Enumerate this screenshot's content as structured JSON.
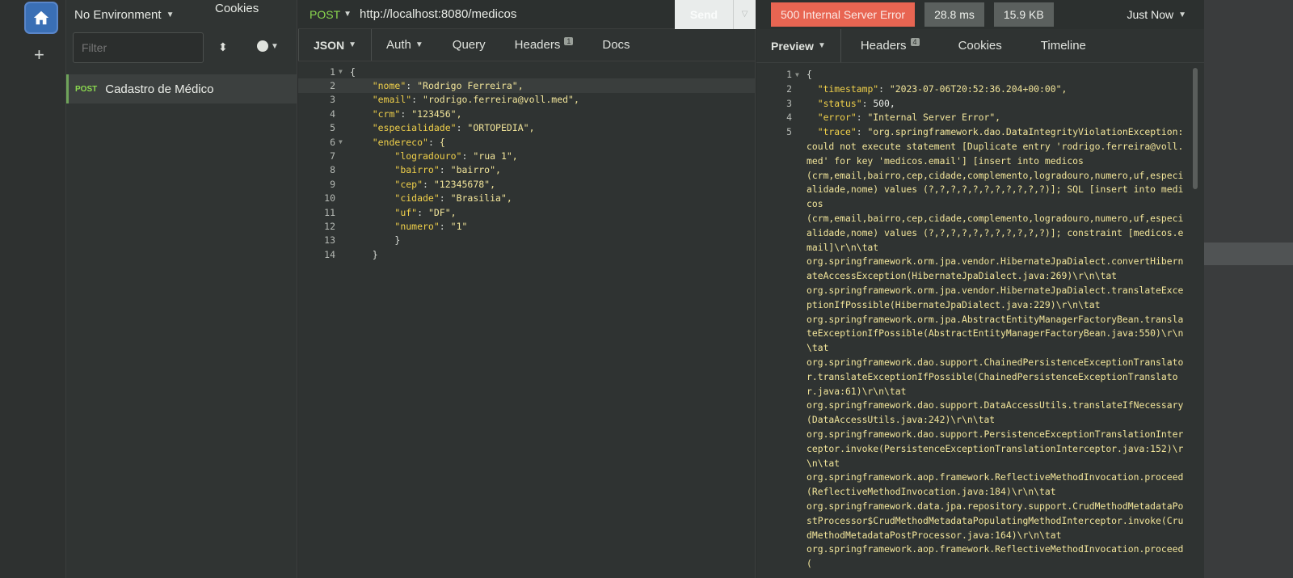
{
  "rail": {
    "home_icon": "home-icon",
    "add_label": "+"
  },
  "sidebar": {
    "environment": "No Environment",
    "cookies": "Cookies",
    "filter_placeholder": "Filter",
    "request": {
      "method": "POST",
      "name": "Cadastro de Médico"
    }
  },
  "request": {
    "method": "POST",
    "url": "http://localhost:8080/medicos",
    "send_label": "Send",
    "tabs": [
      {
        "label": "JSON",
        "badge": ""
      },
      {
        "label": "Auth",
        "badge": ""
      },
      {
        "label": "Query",
        "badge": ""
      },
      {
        "label": "Headers",
        "badge": "1"
      },
      {
        "label": "Docs",
        "badge": ""
      }
    ],
    "body_lines": [
      {
        "n": "1",
        "text": "{"
      },
      {
        "n": "2",
        "key": "\"nome\"",
        "val": "\"Rodrigo Ferreira\","
      },
      {
        "n": "3",
        "key": "\"email\"",
        "val": "\"rodrigo.ferreira@voll.med\","
      },
      {
        "n": "4",
        "key": "\"crm\"",
        "val": "\"123456\","
      },
      {
        "n": "5",
        "key": "\"especialidade\"",
        "val": "\"ORTOPEDIA\","
      },
      {
        "n": "6",
        "key": "\"endereco\"",
        "val": "{"
      },
      {
        "n": "7",
        "key": "\"logradouro\"",
        "val": "\"rua 1\","
      },
      {
        "n": "8",
        "key": "\"bairro\"",
        "val": "\"bairro\","
      },
      {
        "n": "9",
        "key": "\"cep\"",
        "val": "\"12345678\","
      },
      {
        "n": "10",
        "key": "\"cidade\"",
        "val": "\"Brasilia\","
      },
      {
        "n": "11",
        "key": "\"uf\"",
        "val": "\"DF\","
      },
      {
        "n": "12",
        "key": "\"numero\"",
        "val": "\"1\""
      },
      {
        "n": "13",
        "text": "}"
      },
      {
        "n": "14",
        "text": "}"
      }
    ]
  },
  "response": {
    "status": "500 Internal Server Error",
    "time": "28.8 ms",
    "size": "15.9 KB",
    "time_ago": "Just Now",
    "tabs": [
      {
        "label": "Preview",
        "badge": ""
      },
      {
        "label": "Headers",
        "badge": "4"
      },
      {
        "label": "Cookies",
        "badge": ""
      },
      {
        "label": "Timeline",
        "badge": ""
      }
    ],
    "lines": [
      {
        "n": "1",
        "text": "{"
      },
      {
        "n": "2",
        "key": "\"timestamp\"",
        "val": "\"2023-07-06T20:52:36.204+00:00\","
      },
      {
        "n": "3",
        "key": "\"status\"",
        "val": "500,"
      },
      {
        "n": "4",
        "key": "\"error\"",
        "val": "\"Internal Server Error\","
      },
      {
        "n": "5",
        "key": "\"trace\"",
        "val": "\"org.springframework.dao.DataIntegrityViolationException:"
      }
    ],
    "trace_continuation": "could not execute statement [Duplicate entry 'rodrigo.ferreira@voll.med' for key 'medicos.email'] [insert into medicos\n(crm,email,bairro,cep,cidade,complemento,logradouro,numero,uf,especialidade,nome) values (?,?,?,?,?,?,?,?,?,?,?)]; SQL [insert into medicos\n(crm,email,bairro,cep,cidade,complemento,logradouro,numero,uf,especialidade,nome) values (?,?,?,?,?,?,?,?,?,?,?)]; constraint [medicos.email]\\r\\n\\tat\norg.springframework.orm.jpa.vendor.HibernateJpaDialect.convertHibernateAccessException(HibernateJpaDialect.java:269)\\r\\n\\tat\norg.springframework.orm.jpa.vendor.HibernateJpaDialect.translateExceptionIfPossible(HibernateJpaDialect.java:229)\\r\\n\\tat\norg.springframework.orm.jpa.AbstractEntityManagerFactoryBean.translateExceptionIfPossible(AbstractEntityManagerFactoryBean.java:550)\\r\\n\\tat\norg.springframework.dao.support.ChainedPersistenceExceptionTranslator.translateExceptionIfPossible(ChainedPersistenceExceptionTranslator.java:61)\\r\\n\\tat\norg.springframework.dao.support.DataAccessUtils.translateIfNecessary(DataAccessUtils.java:242)\\r\\n\\tat\norg.springframework.dao.support.PersistenceExceptionTranslationInterceptor.invoke(PersistenceExceptionTranslationInterceptor.java:152)\\r\\n\\tat\norg.springframework.aop.framework.ReflectiveMethodInvocation.proceed(ReflectiveMethodInvocation.java:184)\\r\\n\\tat\norg.springframework.data.jpa.repository.support.CrudMethodMetadataPostProcessor$CrudMethodMetadataPopulatingMethodInterceptor.invoke(CrudMethodMetadataPostProcessor.java:164)\\r\\n\\tat\norg.springframework.aop.framework.ReflectiveMethodInvocation.proceed("
  },
  "colors": {
    "accent_post": "#8bd94f",
    "status_error": "#e86552",
    "json_key": "#f0d04a",
    "json_string": "#f2e59a"
  }
}
